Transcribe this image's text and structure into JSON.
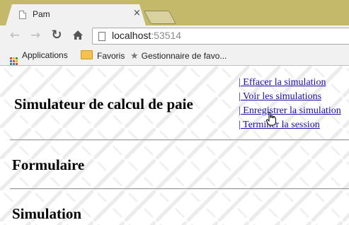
{
  "browser": {
    "tab": {
      "title": "Pam",
      "close_glyph": "×"
    },
    "address_bar": {
      "host": "localhost",
      "port": ":53514"
    },
    "bookmarks": [
      {
        "label": "Applications",
        "icon": "apps-icon"
      },
      {
        "label": "Favoris",
        "icon": "folder-icon"
      },
      {
        "label": "Gestionnaire de favo...",
        "icon": "star-icon"
      }
    ]
  },
  "page": {
    "title": "Simulateur de calcul de paie",
    "menu": [
      "| Effacer la simulation",
      "| Voir les simulations",
      "| Enregistrer la simulation",
      "| Terminer la session"
    ],
    "sections": [
      "Formulaire",
      "Simulation"
    ]
  },
  "colors": {
    "frame": "#c4b96a",
    "toolbar": "#f1f1f1",
    "link": "#1a0dab"
  }
}
